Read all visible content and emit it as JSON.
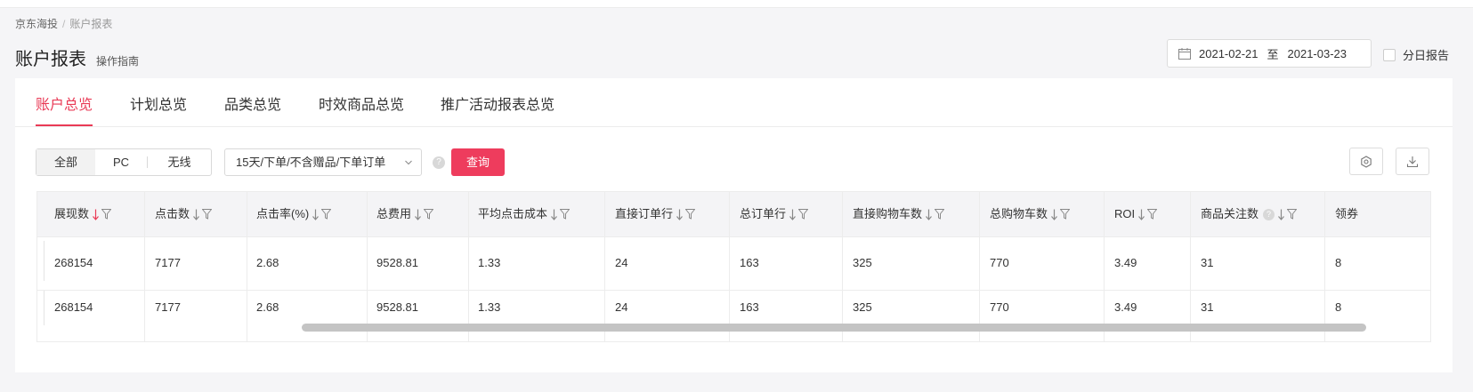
{
  "breadcrumb": {
    "root": "京东海投",
    "separator": "/",
    "current": "账户报表"
  },
  "page": {
    "title": "账户报表",
    "guide_link": "操作指南"
  },
  "date_range": {
    "start": "2021-02-21",
    "to": "至",
    "end": "2021-03-23"
  },
  "daily_report": {
    "label": "分日报告",
    "checked": false
  },
  "tabs": [
    {
      "label": "账户总览",
      "active": true
    },
    {
      "label": "计划总览",
      "active": false
    },
    {
      "label": "品类总览",
      "active": false
    },
    {
      "label": "时效商品总览",
      "active": false
    },
    {
      "label": "推广活动报表总览",
      "active": false
    }
  ],
  "filters": {
    "device_options": [
      {
        "label": "全部",
        "selected": true
      },
      {
        "label": "PC",
        "selected": false
      },
      {
        "label": "无线",
        "selected": false
      }
    ],
    "attribution_select": "15天/下单/不含赠品/下单订单",
    "help": "?",
    "query_button": "查询"
  },
  "toolbar": {
    "settings_icon": "gear-icon",
    "download_icon": "download-icon"
  },
  "table": {
    "columns": [
      {
        "label": "展现数",
        "sort_active": true
      },
      {
        "label": "点击数",
        "sort_active": false
      },
      {
        "label": "点击率(%)",
        "sort_active": false
      },
      {
        "label": "总费用",
        "sort_active": false
      },
      {
        "label": "平均点击成本",
        "sort_active": false
      },
      {
        "label": "直接订单行",
        "sort_active": false
      },
      {
        "label": "总订单行",
        "sort_active": false
      },
      {
        "label": "直接购物车数",
        "sort_active": false
      },
      {
        "label": "总购物车数",
        "sort_active": false
      },
      {
        "label": "ROI",
        "sort_active": false
      },
      {
        "label": "商品关注数",
        "sort_active": false,
        "has_help": true
      },
      {
        "label": "领券",
        "sort_active": false
      }
    ],
    "rows": [
      [
        "268154",
        "7177",
        "2.68",
        "9528.81",
        "1.33",
        "24",
        "163",
        "325",
        "770",
        "3.49",
        "31",
        "8"
      ],
      [
        "268154",
        "7177",
        "2.68",
        "9528.81",
        "1.33",
        "24",
        "163",
        "325",
        "770",
        "3.49",
        "31",
        "8"
      ]
    ]
  },
  "colors": {
    "accent": "#e93a56",
    "button": "#ee3c5d",
    "header_bg": "#f4f4f6"
  }
}
